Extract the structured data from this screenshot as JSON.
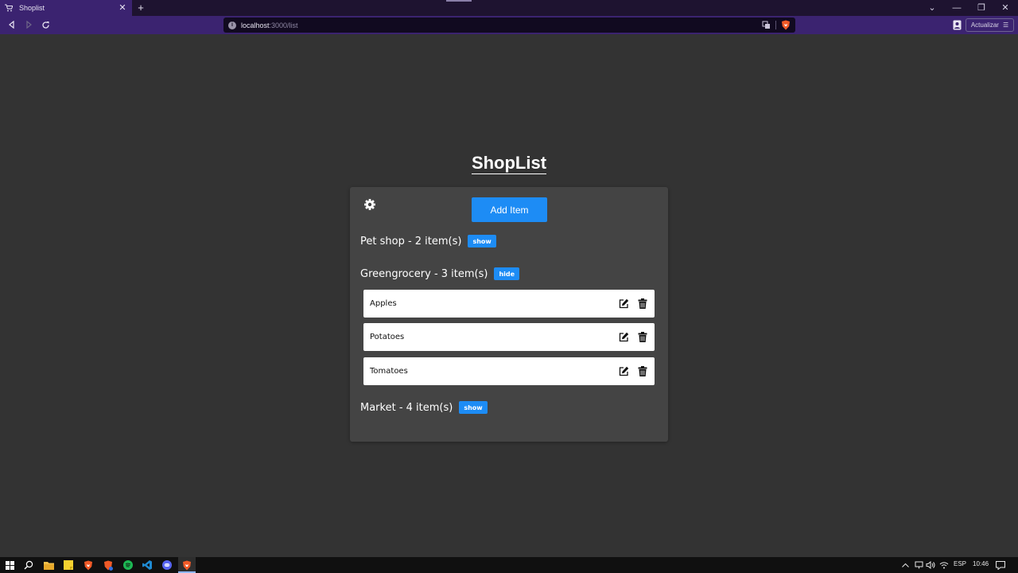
{
  "browser": {
    "tab_title": "Shoplist",
    "tab_close": "✕",
    "new_tab": "+",
    "url_host": "localhost",
    "url_path": ":3000/list",
    "update_label": "Actualizar",
    "update_menu_glyph": "☰",
    "window_controls": {
      "tabs_list": "⌄",
      "minimize": "—",
      "restore": "❐",
      "close": "✕"
    }
  },
  "app": {
    "title": "ShopList",
    "add_item_label": "Add Item",
    "groups": [
      {
        "title": "Pet shop - 2 item(s)",
        "toggle": "show",
        "items": []
      },
      {
        "title": "Greengrocery - 3 item(s)",
        "toggle": "hide",
        "items": [
          {
            "name": "Apples"
          },
          {
            "name": "Potatoes"
          },
          {
            "name": "Tomatoes"
          }
        ]
      },
      {
        "title": "Market - 4 item(s)",
        "toggle": "show",
        "items": []
      }
    ]
  },
  "taskbar": {
    "language": "ESP",
    "time": "10:46"
  },
  "colors": {
    "page_bg": "#333333",
    "card_bg": "#444444",
    "accent": "#1d8cf5",
    "browser_chrome": "#3b2370"
  }
}
